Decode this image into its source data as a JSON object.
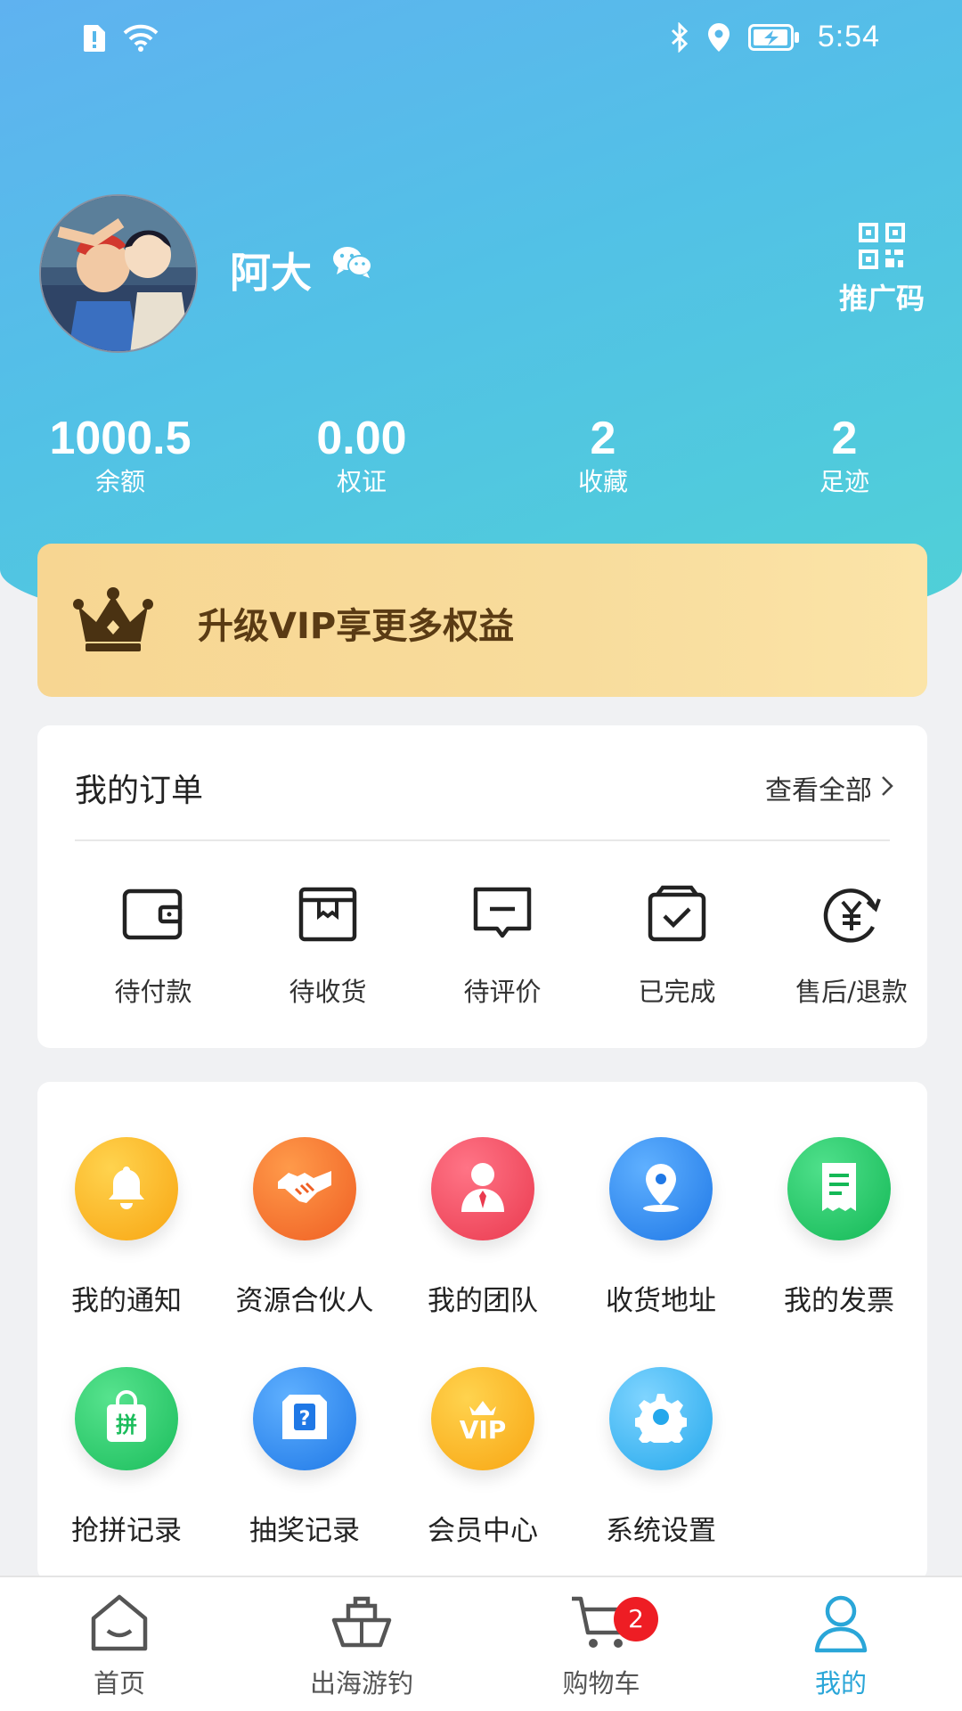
{
  "status_bar": {
    "time": "5:54",
    "icons": [
      "sim-alert-icon",
      "wifi-icon",
      "bluetooth-icon",
      "location-icon",
      "battery-charging-icon"
    ]
  },
  "profile": {
    "name": "阿大",
    "login_icon": "wechat-icon",
    "qr_label": "推广码"
  },
  "stats": [
    {
      "value": "1000.5",
      "label": "余额"
    },
    {
      "value": "0.00",
      "label": "权证"
    },
    {
      "value": "2",
      "label": "收藏"
    },
    {
      "value": "2",
      "label": "足迹"
    }
  ],
  "vip": {
    "text": "升级VIP享更多权益",
    "icon": "crown-icon"
  },
  "orders": {
    "title": "我的订单",
    "view_all": "查看全部",
    "items": [
      {
        "label": "待付款",
        "icon": "wallet-icon"
      },
      {
        "label": "待收货",
        "icon": "package-icon"
      },
      {
        "label": "待评价",
        "icon": "comment-icon"
      },
      {
        "label": "已完成",
        "icon": "completed-box-icon"
      },
      {
        "label": "售后/退款",
        "icon": "refund-icon"
      }
    ]
  },
  "services": [
    {
      "label": "我的通知",
      "icon": "bell-icon",
      "color": "#f9b21b"
    },
    {
      "label": "资源合伙人",
      "icon": "handshake-icon",
      "color": "#f36f2d"
    },
    {
      "label": "我的团队",
      "icon": "team-icon",
      "color": "#f0475b"
    },
    {
      "label": "收货地址",
      "icon": "location-pin-icon",
      "color": "#2f8ef0"
    },
    {
      "label": "我的发票",
      "icon": "invoice-icon",
      "color": "#21c862"
    },
    {
      "label": "抢拼记录",
      "icon": "group-buy-bag-icon",
      "color": "#2ccb6a"
    },
    {
      "label": "抽奖记录",
      "icon": "lottery-box-icon",
      "color": "#2f8ef0"
    },
    {
      "label": "会员中心",
      "icon": "vip-crown-icon",
      "color": "#f9b21b"
    },
    {
      "label": "系统设置",
      "icon": "gear-icon",
      "color": "#35b4ef"
    }
  ],
  "tabs": [
    {
      "label": "首页",
      "icon": "home-icon"
    },
    {
      "label": "出海游钓",
      "icon": "ship-icon"
    },
    {
      "label": "购物车",
      "icon": "cart-icon",
      "badge": "2"
    },
    {
      "label": "我的",
      "icon": "person-icon",
      "active": true
    }
  ],
  "colors": {
    "accent": "#2aa6d8",
    "header_start": "#5fb2f0",
    "header_end": "#4fd1d6",
    "vip_text": "#5a3b14",
    "badge": "#ee1d24"
  }
}
